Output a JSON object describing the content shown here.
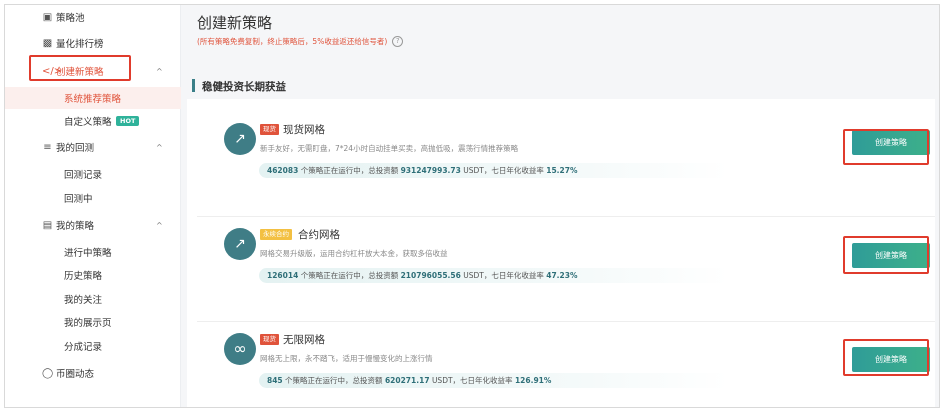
{
  "sidebar": {
    "items": [
      {
        "label": "策略池",
        "icon": "document-icon"
      },
      {
        "label": "量化排行榜",
        "icon": "bar-chart-icon"
      },
      {
        "label": "创建新策略",
        "icon": "code-icon",
        "arrow": "^"
      },
      {
        "label": "系统推荐策略"
      },
      {
        "label": "自定义策略",
        "badge": "HOT"
      },
      {
        "label": "我的回测",
        "icon": "sliders-icon",
        "arrow": "^"
      },
      {
        "label": "回测记录"
      },
      {
        "label": "回测中"
      },
      {
        "label": "我的策略",
        "icon": "clipboard-icon",
        "arrow": "^"
      },
      {
        "label": "进行中策略"
      },
      {
        "label": "历史策略"
      },
      {
        "label": "我的关注"
      },
      {
        "label": "我的展示页"
      },
      {
        "label": "分成记录"
      },
      {
        "label": "币圈动态",
        "icon": "globe-icon"
      }
    ]
  },
  "main": {
    "title": "创建新策略",
    "subtitle": "(所有策略免费复制，终止策略后，5%收益返还给信号者)",
    "help_icon": "?",
    "section_title": "稳健投资长期获益",
    "cards": [
      {
        "tag": "现货",
        "tag_color": "#e0533b",
        "name": "现货网格",
        "desc": "新手友好，无需盯盘，7*24小时自动挂单买卖，高抛低吸，震荡行情推荐策略",
        "count": "462083",
        "count_suffix": "个策略正在运行中，总投资额",
        "invest": "931247993.73",
        "invest_suffix": "USDT，七日年化收益率",
        "rate": "15.27%",
        "button": "创建策略",
        "icon": "chart-up-icon"
      },
      {
        "tag": "永续合约",
        "tag_color": "#f3c042",
        "name": "合约网格",
        "desc": "网格交易升级版，运用合约杠杆放大本金，获取多倍收益",
        "count": "126014",
        "count_suffix": "个策略正在运行中，总投资额",
        "invest": "210796055.56",
        "invest_suffix": "USDT，七日年化收益率",
        "rate": "47.23%",
        "button": "创建策略",
        "icon": "chart-up-icon"
      },
      {
        "tag": "现货",
        "tag_color": "#e0533b",
        "name": "无限网格",
        "desc": "网格无上限，永不踏飞，适用于慢慢变化的上涨行情",
        "count": "845",
        "count_suffix": "个策略正在运行中，总投资额",
        "invest": "620271.17",
        "invest_suffix": "USDT，七日年化收益率",
        "rate": "126.91%",
        "button": "创建策略",
        "icon": "infinity-icon"
      }
    ]
  }
}
